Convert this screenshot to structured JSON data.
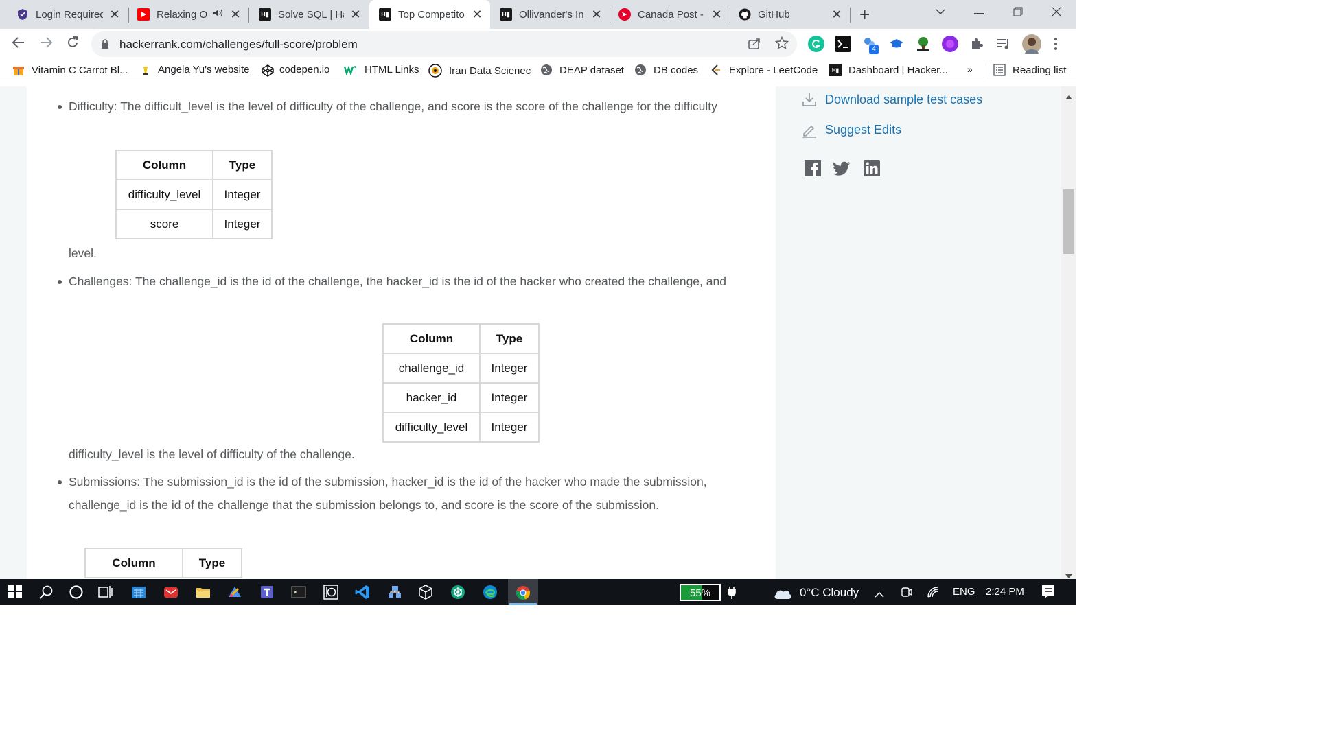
{
  "browser": {
    "tabs": [
      {
        "title": "Login Required",
        "favicon": "shield-icon",
        "active": false
      },
      {
        "title": "Relaxing O",
        "favicon": "youtube-icon",
        "active": false,
        "audio": true
      },
      {
        "title": "Solve SQL | Ha",
        "favicon": "hackerrank-icon",
        "active": false
      },
      {
        "title": "Top Competito",
        "favicon": "hackerrank-icon",
        "active": true
      },
      {
        "title": "Ollivander's In",
        "favicon": "hackerrank-icon",
        "active": false
      },
      {
        "title": "Canada Post -",
        "favicon": "canada-post-icon",
        "active": false
      },
      {
        "title": "GitHub",
        "favicon": "github-icon",
        "active": false
      }
    ],
    "new_tab_label": "+",
    "close_glyph": "✕",
    "url": "hackerrank.com/challenges/full-score/problem",
    "extension_badge": "4",
    "bookmarks": [
      {
        "label": "Vitamin C Carrot Bl..."
      },
      {
        "label": "Angela Yu's website"
      },
      {
        "label": "codepen.io"
      },
      {
        "label": "HTML Links"
      },
      {
        "label": "Iran Data Scienec"
      },
      {
        "label": "DEAP dataset"
      },
      {
        "label": "DB codes"
      },
      {
        "label": "Explore - LeetCode"
      },
      {
        "label": "Dashboard | Hacker..."
      }
    ],
    "bookmarks_overflow": "»",
    "reading_list": "Reading list"
  },
  "main": {
    "difficulty": {
      "text": "Difficulty: The difficult_level is the level of difficulty of the challenge, and score is the score of the challenge for the difficulty",
      "continuation": "level.",
      "headers": [
        "Column",
        "Type"
      ],
      "rows": [
        [
          "difficulty_level",
          "Integer"
        ],
        [
          "score",
          "Integer"
        ]
      ]
    },
    "challenges": {
      "text": "Challenges: The challenge_id is the id of the challenge, the hacker_id is the id of the hacker who created the challenge, and",
      "continuation": "difficulty_level is the level of difficulty of the challenge.",
      "headers": [
        "Column",
        "Type"
      ],
      "rows": [
        [
          "challenge_id",
          "Integer"
        ],
        [
          "hacker_id",
          "Integer"
        ],
        [
          "difficulty_level",
          "Integer"
        ]
      ]
    },
    "submissions": {
      "text_line1": "Submissions: The submission_id is the id of the submission, hacker_id is the id of the hacker who made the submission,",
      "text_line2": "challenge_id is the id of the challenge that the submission belongs to, and score is the score of the submission.",
      "headers": [
        "Column",
        "Type"
      ]
    }
  },
  "sidebar": {
    "download_label": "Download sample test cases",
    "suggest_label": "Suggest Edits",
    "link_color": "#1a74b4"
  },
  "taskbar": {
    "battery_percent": "55%",
    "battery_level": 0.55,
    "weather": "0°C  Cloudy",
    "language": "ENG",
    "time": "2:24 PM"
  }
}
